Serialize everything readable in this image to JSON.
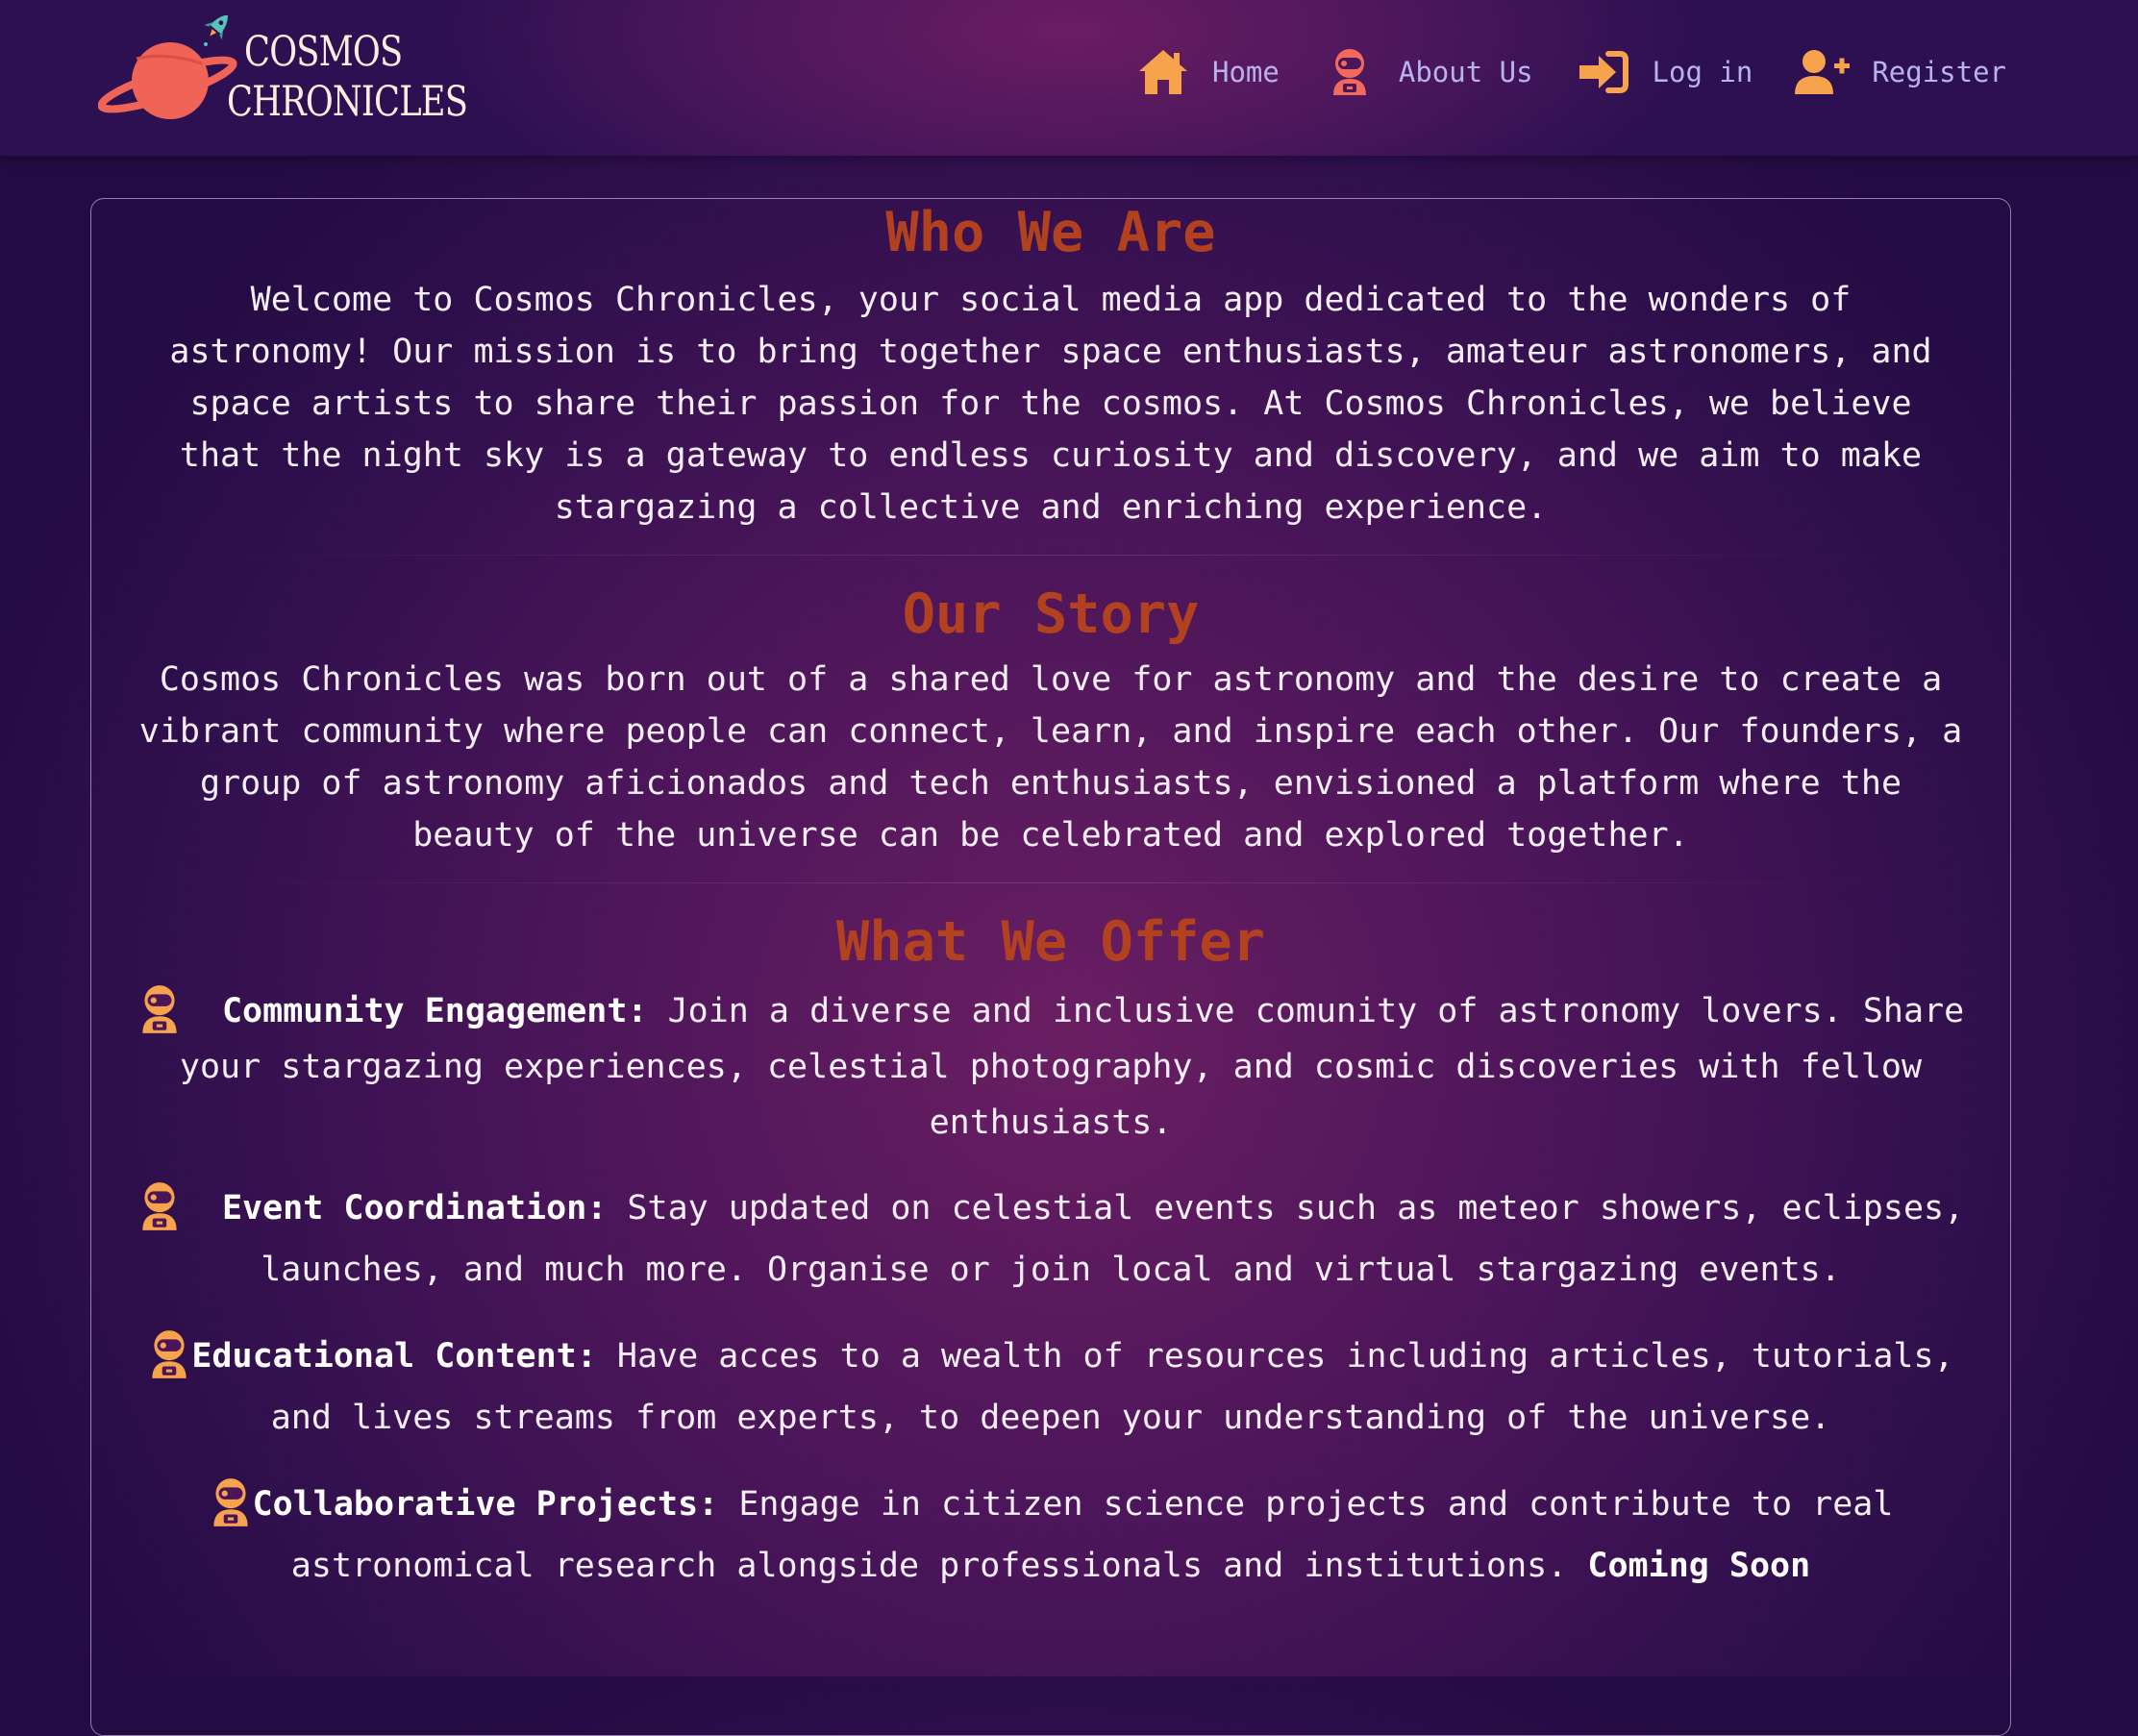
{
  "brand": {
    "line1": "COSMOS",
    "line2": "CHRONICLES",
    "logo_icon": "planet-rocket-icon"
  },
  "nav": {
    "items": [
      {
        "label": "Home",
        "icon": "home-icon"
      },
      {
        "label": "About Us",
        "icon": "astronaut-icon"
      },
      {
        "label": "Log in",
        "icon": "sign-in-icon"
      },
      {
        "label": "Register",
        "icon": "user-plus-icon"
      }
    ]
  },
  "colors": {
    "accent_orange": "#f7a24c",
    "heading_rust": "#b1411f",
    "astronaut_coral": "#f36a5d",
    "nav_text": "#b9b2ef"
  },
  "sections": {
    "who": {
      "title": "Who We Are",
      "text": "Welcome to Cosmos Chronicles, your social media app dedicated to the wonders of astronomy! Our mission is to bring together space enthusiasts, amateur astronomers, and space artists to share their passion for the cosmos. At Cosmos Chronicles, we believe that the night sky is a gateway to endless curiosity and discovery, and we aim to make stargazing a collective and enriching experience."
    },
    "story": {
      "title": "Our Story",
      "text": "Cosmos Chronicles was born out of a shared love for astronomy and the desire to create a vibrant community where people can connect, learn, and inspire each other. Our founders, a group of astronomy aficionados and tech enthusiasts, envisioned a platform where the beauty of the universe can be celebrated and explored together."
    },
    "offer": {
      "title": "What We Offer",
      "items": [
        {
          "heading": "Community Engagement:",
          "text": "Join a diverse and inclusive comunity of astronomy lovers. Share your stargazing experiences, celestial photography, and cosmic discoveries with fellow enthusiasts.",
          "suffix": ""
        },
        {
          "heading": "Event Coordination:",
          "text": "Stay updated on celestial events such as meteor showers, eclipses, launches, and much more. Organise or join local and virtual stargazing events.",
          "suffix": ""
        },
        {
          "heading": "Educational Content:",
          "text": "Have acces to a wealth of resources including articles, tutorials, and lives streams from experts, to deepen your understanding of the universe.",
          "suffix": ""
        },
        {
          "heading": "Collaborative Projects:",
          "text": "Engage in citizen science projects and contribute to real astronomical research alongside professionals and institutions.",
          "suffix": "Coming Soon"
        }
      ]
    }
  }
}
